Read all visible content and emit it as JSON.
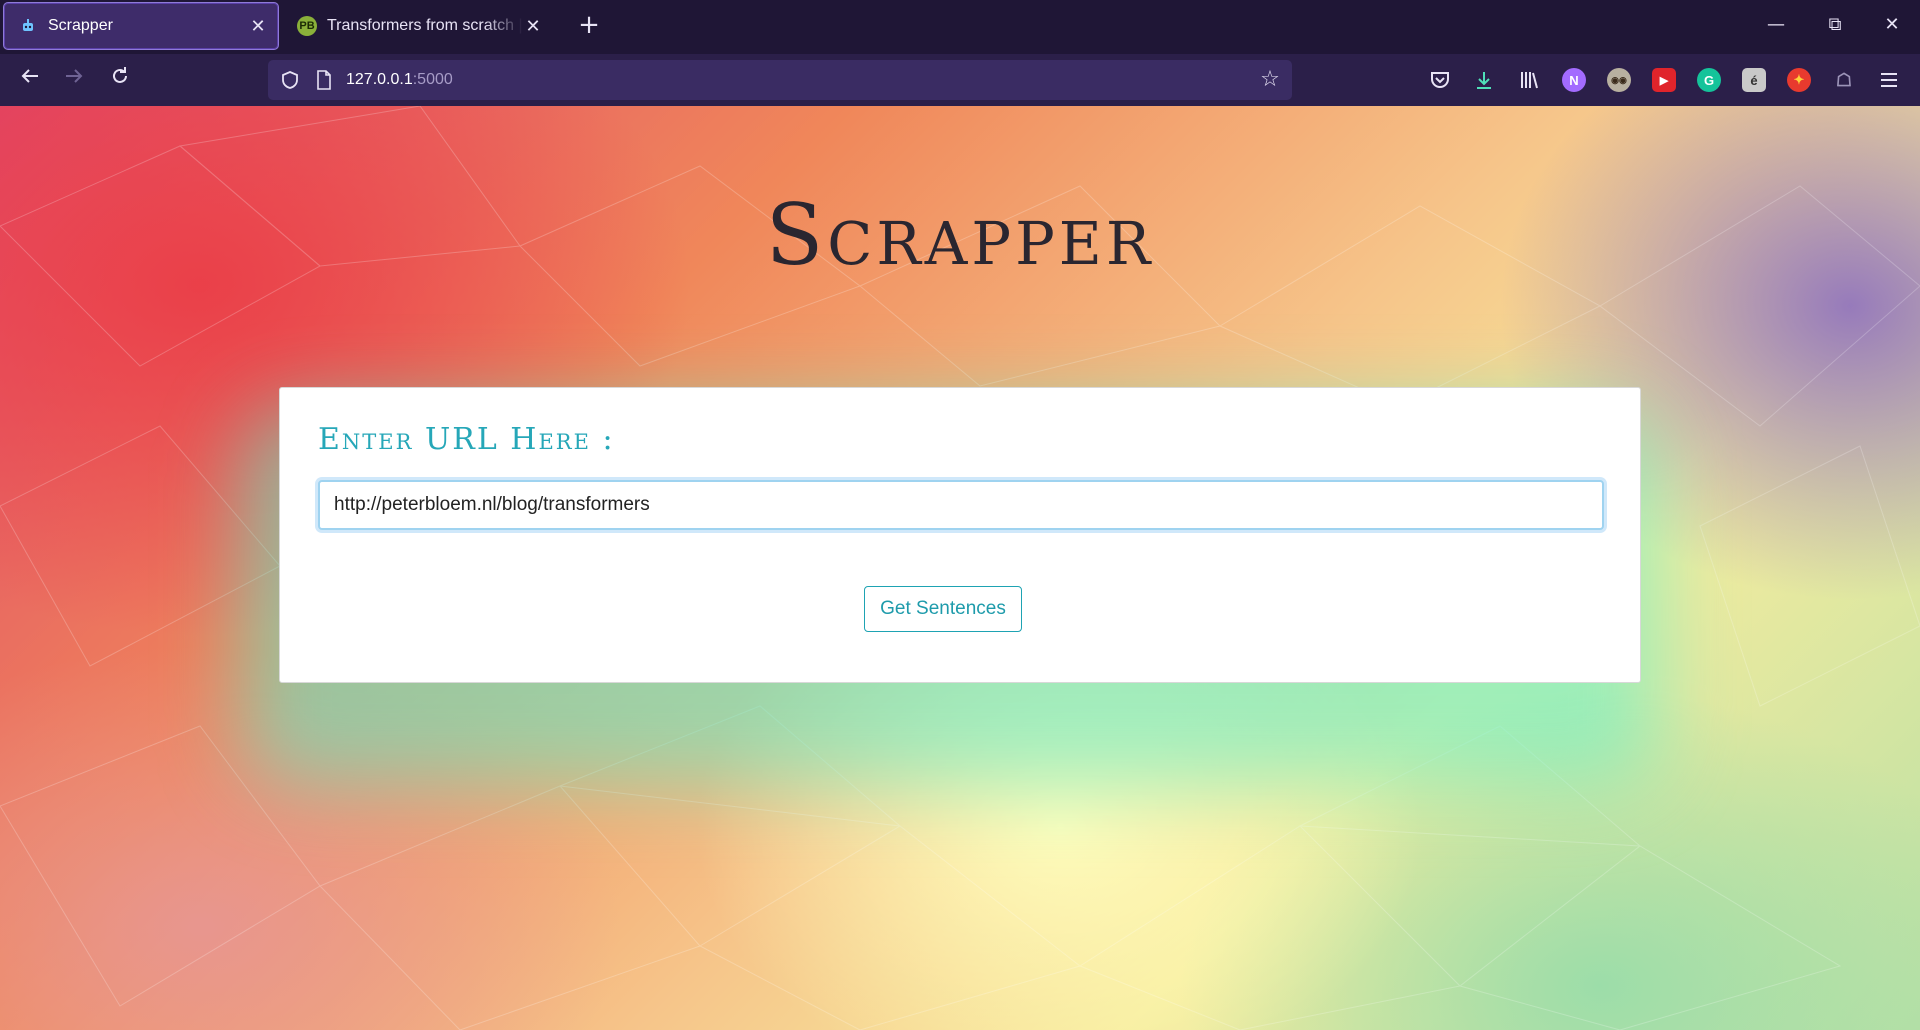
{
  "browser": {
    "tabs": [
      {
        "title": "Scrapper",
        "active": true,
        "favicon": "robot-icon"
      },
      {
        "title": "Transformers from scratch | peterbloem.nl",
        "active": false,
        "favicon": "PB"
      }
    ],
    "address": {
      "host": "127.0.0.1",
      "port": ":5000"
    },
    "icons": {
      "back": "arrow-left-icon",
      "forward": "arrow-right-icon",
      "reload": "reload-icon",
      "shield": "shield-icon",
      "page": "page-icon",
      "bookmark": "star-icon",
      "pocket": "pocket-icon",
      "downloads": "download-icon",
      "library": "library-icon",
      "menu": "hamburger-menu-icon"
    },
    "extensions": [
      {
        "name": "notion-extension",
        "glyph": "N",
        "color": "#a36bff"
      },
      {
        "name": "owl-extension",
        "glyph": "◉◉",
        "color": "#b8b0a0"
      },
      {
        "name": "youtube-extension",
        "glyph": "▶",
        "color": "#e0242b"
      },
      {
        "name": "grammarly-extension",
        "glyph": "G",
        "color": "#15c39a"
      },
      {
        "name": "translate-extension",
        "glyph": "é",
        "color": "#c9c9c9"
      },
      {
        "name": "colorzilla-extension",
        "glyph": "✦",
        "color": "#e83a2e"
      },
      {
        "name": "octotree-extension",
        "glyph": "☖",
        "color": "#9c94b8"
      }
    ],
    "window_controls": {
      "minimize": "—",
      "restore": "⧉",
      "close": "✕"
    }
  },
  "page": {
    "title": "Scrapper",
    "form": {
      "label": "Enter URL Here :",
      "url_value": "http://peterbloem.nl/blog/transformers",
      "submit_label": "Get Sentences"
    }
  },
  "colors": {
    "accent": "#1e9bab",
    "label": "#26a7b8",
    "chrome_dark": "#1f1636",
    "chrome": "#2b1f49"
  }
}
